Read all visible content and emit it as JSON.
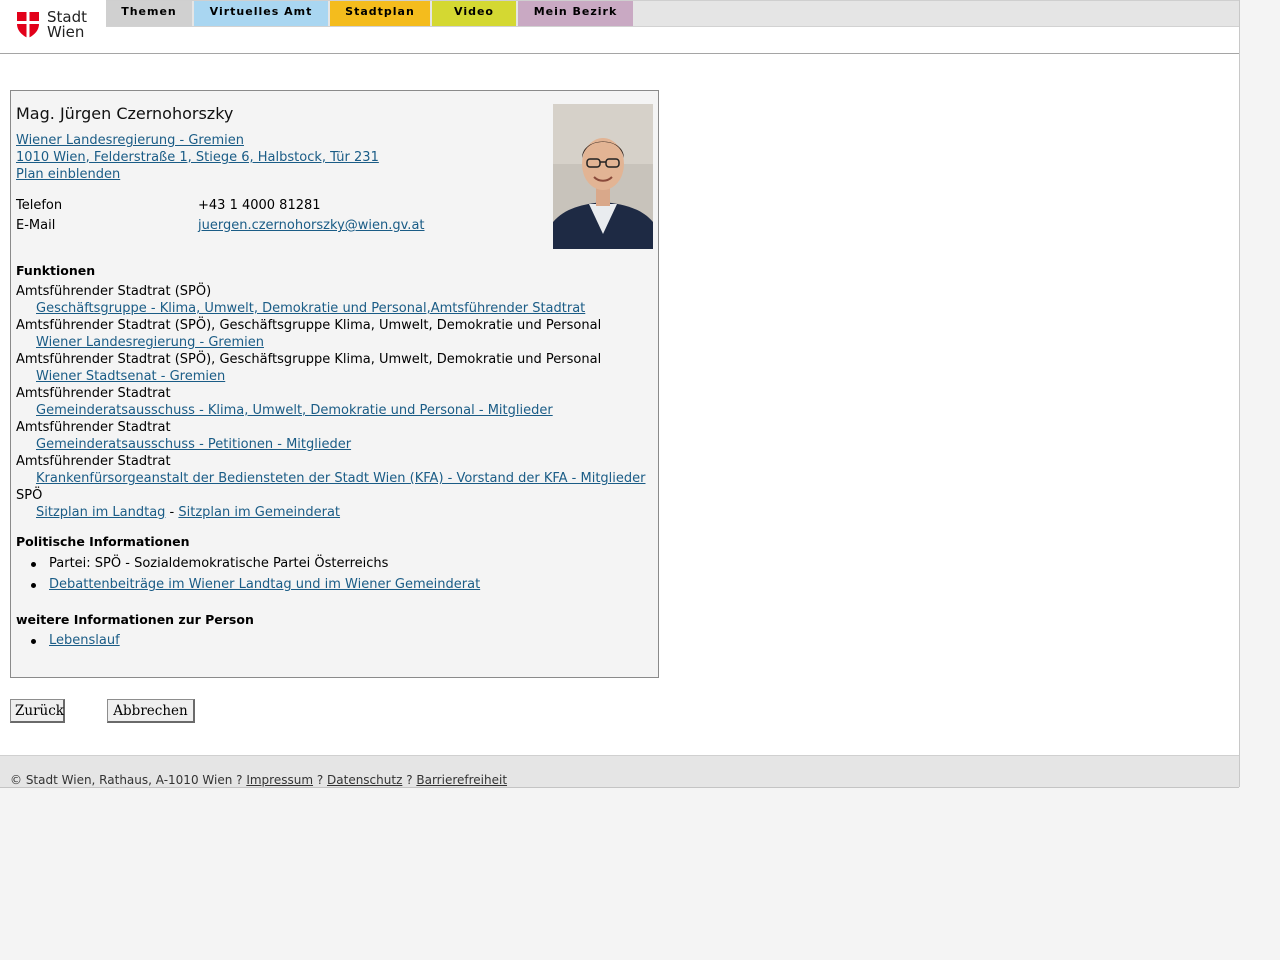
{
  "header": {
    "logo_text_line1": "Stadt",
    "logo_text_line2": "Wien",
    "tabs": [
      {
        "label": "Themen"
      },
      {
        "label": "Virtuelles Amt"
      },
      {
        "label": "Stadtplan"
      },
      {
        "label": "Video"
      },
      {
        "label": "Mein Bezirk"
      }
    ],
    "colors": {
      "themen": "#d0d0d0",
      "amt": "#a9d6f1",
      "plan": "#f4bc1d",
      "video": "#d4d832",
      "bezirk": "#c9a9c3",
      "logo_red": "#e2001a"
    }
  },
  "person": {
    "name": "Mag. Jürgen Czernohorszky",
    "org_link": "Wiener Landesregierung - Gremien ",
    "address_link": "1010 Wien, Felderstraße 1, Stiege 6, Halbstock, Tür 231",
    "plan_link": "Plan einblenden",
    "phone_label": "Telefon",
    "phone_value": "+43 1 4000 81281",
    "email_label": "E-Mail",
    "email_value": "juergen.czernohorszky@wien.gv.at"
  },
  "functions": {
    "heading": "Funktionen",
    "items": [
      {
        "text": "Amtsführender Stadtrat (SPÖ)",
        "link": "Geschäftsgruppe - Klima, Umwelt, Demokratie und Personal,Amtsführender Stadtrat"
      },
      {
        "text": "Amtsführender Stadtrat (SPÖ), Geschäftsgruppe Klima, Umwelt, Demokratie und Personal",
        "link": "Wiener Landesregierung - Gremien"
      },
      {
        "text": "Amtsführender Stadtrat (SPÖ), Geschäftsgruppe Klima, Umwelt, Demokratie und Personal",
        "link": "Wiener Stadtsenat - Gremien"
      },
      {
        "text": "Amtsführender Stadtrat",
        "link": "Gemeinderatsausschuss - Klima, Umwelt, Demokratie und Personal - Mitglieder"
      },
      {
        "text": "Amtsführender Stadtrat",
        "link": "Gemeinderatsausschuss - Petitionen - Mitglieder"
      },
      {
        "text": "Amtsführender Stadtrat",
        "link": "Krankenfürsorgeanstalt der Bediensteten der Stadt Wien (KFA) - Vorstand der KFA - Mitglieder"
      }
    ],
    "party_text": "SPÖ",
    "seat_link_1": "Sitzplan im Landtag",
    "seat_separator": " - ",
    "seat_link_2": "Sitzplan im Gemeinderat"
  },
  "political": {
    "heading": "Politische Informationen",
    "party": "Partei: SPÖ - Sozialdemokratische Partei Österreichs",
    "debate_link": "Debattenbeiträge im Wiener Landtag und im Wiener Gemeinderat"
  },
  "more": {
    "heading": "weitere Informationen zur Person",
    "cv_link": "Lebenslauf"
  },
  "buttons": {
    "back": "Zurück",
    "cancel": "Abbrechen"
  },
  "footer": {
    "copyright": "© Stadt Wien, Rathaus, A-1010 Wien ? ",
    "imprint": "Impressum",
    "sep1": " ? ",
    "privacy": "Datenschutz",
    "sep2": " ? ",
    "accessibility": "Barrierefreiheit"
  }
}
